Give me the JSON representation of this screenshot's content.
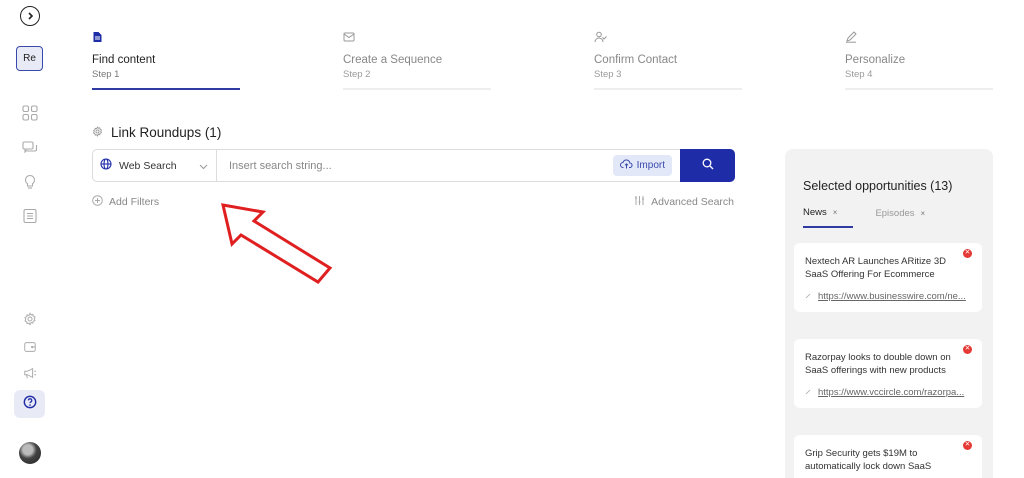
{
  "sidebar": {
    "workspace": "Re",
    "icons": [
      "chevron-circle-icon",
      "grid-icon",
      "chat-icon",
      "bulb-icon",
      "list-icon",
      "settings-icon",
      "wallet-icon",
      "megaphone-icon",
      "help-icon"
    ]
  },
  "steps": [
    {
      "title": "Find content",
      "sub": "Step 1",
      "icon": "document-icon"
    },
    {
      "title": "Create a Sequence",
      "sub": "Step 2",
      "icon": "mail-icon"
    },
    {
      "title": "Confirm Contact",
      "sub": "Step 3",
      "icon": "user-check-icon"
    },
    {
      "title": "Personalize",
      "sub": "Step 4",
      "icon": "pen-icon"
    }
  ],
  "section": {
    "title": "Link Roundups (1)"
  },
  "search": {
    "source": "Web Search",
    "placeholder": "Insert search string...",
    "import_label": "Import"
  },
  "filters": {
    "add": "Add Filters",
    "advanced": "Advanced Search"
  },
  "panel": {
    "title": "Selected opportunities (13)",
    "tabs": [
      {
        "label": "News",
        "close": "×"
      },
      {
        "label": "Episodes",
        "close": "×"
      }
    ],
    "cards": [
      {
        "title": "Nextech AR Launches ARitize 3D SaaS Offering For Ecommerce",
        "link": "https://www.businesswire.com/ne..."
      },
      {
        "title": "Razorpay looks to double down on SaaS offerings with new products",
        "link": "https://www.vccircle.com/razorpa..."
      },
      {
        "title": "Grip Security gets $19M to automatically lock down SaaS",
        "link": ""
      }
    ]
  },
  "colors": {
    "accent": "#1f2ca8",
    "arrow": "#e02020"
  }
}
